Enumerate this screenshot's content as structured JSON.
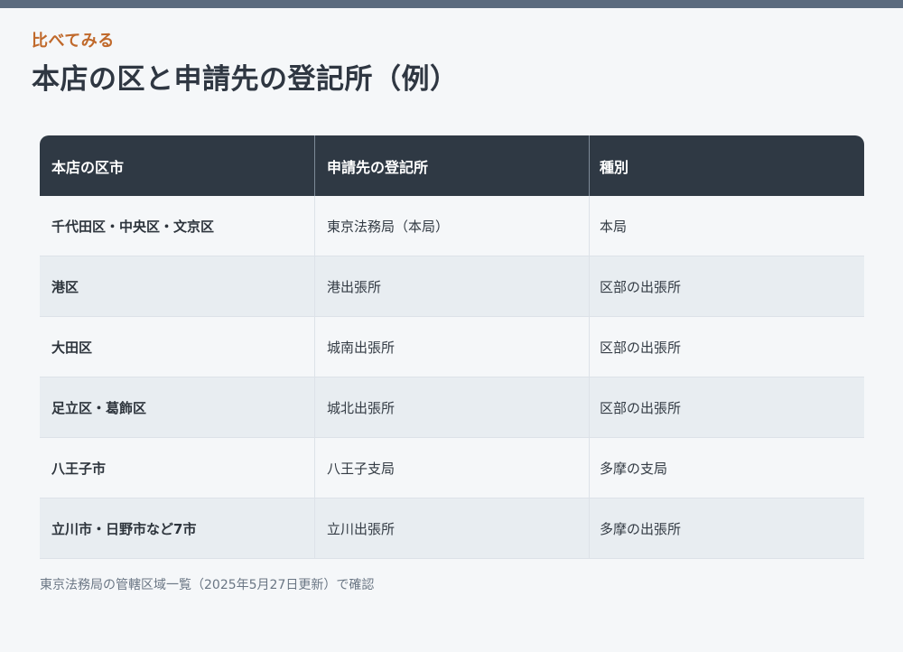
{
  "eyebrow": "比べてみる",
  "title": "本店の区と申請先の登記所（例）",
  "table": {
    "headers": [
      "本店の区市",
      "申請先の登記所",
      "種別"
    ],
    "rows": [
      [
        "千代田区・中央区・文京区",
        "東京法務局（本局）",
        "本局"
      ],
      [
        "港区",
        "港出張所",
        "区部の出張所"
      ],
      [
        "大田区",
        "城南出張所",
        "区部の出張所"
      ],
      [
        "足立区・葛飾区",
        "城北出張所",
        "区部の出張所"
      ],
      [
        "八王子市",
        "八王子支局",
        "多摩の支局"
      ],
      [
        "立川市・日野市など7市",
        "立川出張所",
        "多摩の出張所"
      ]
    ]
  },
  "footnote": "東京法務局の管轄区域一覧（2025年5月27日更新）で確認",
  "colors": {
    "accent": "#c0692b",
    "header_bg": "#2f3944",
    "top_bar": "#5b6b7e",
    "alt_row": "#e8edf1"
  }
}
